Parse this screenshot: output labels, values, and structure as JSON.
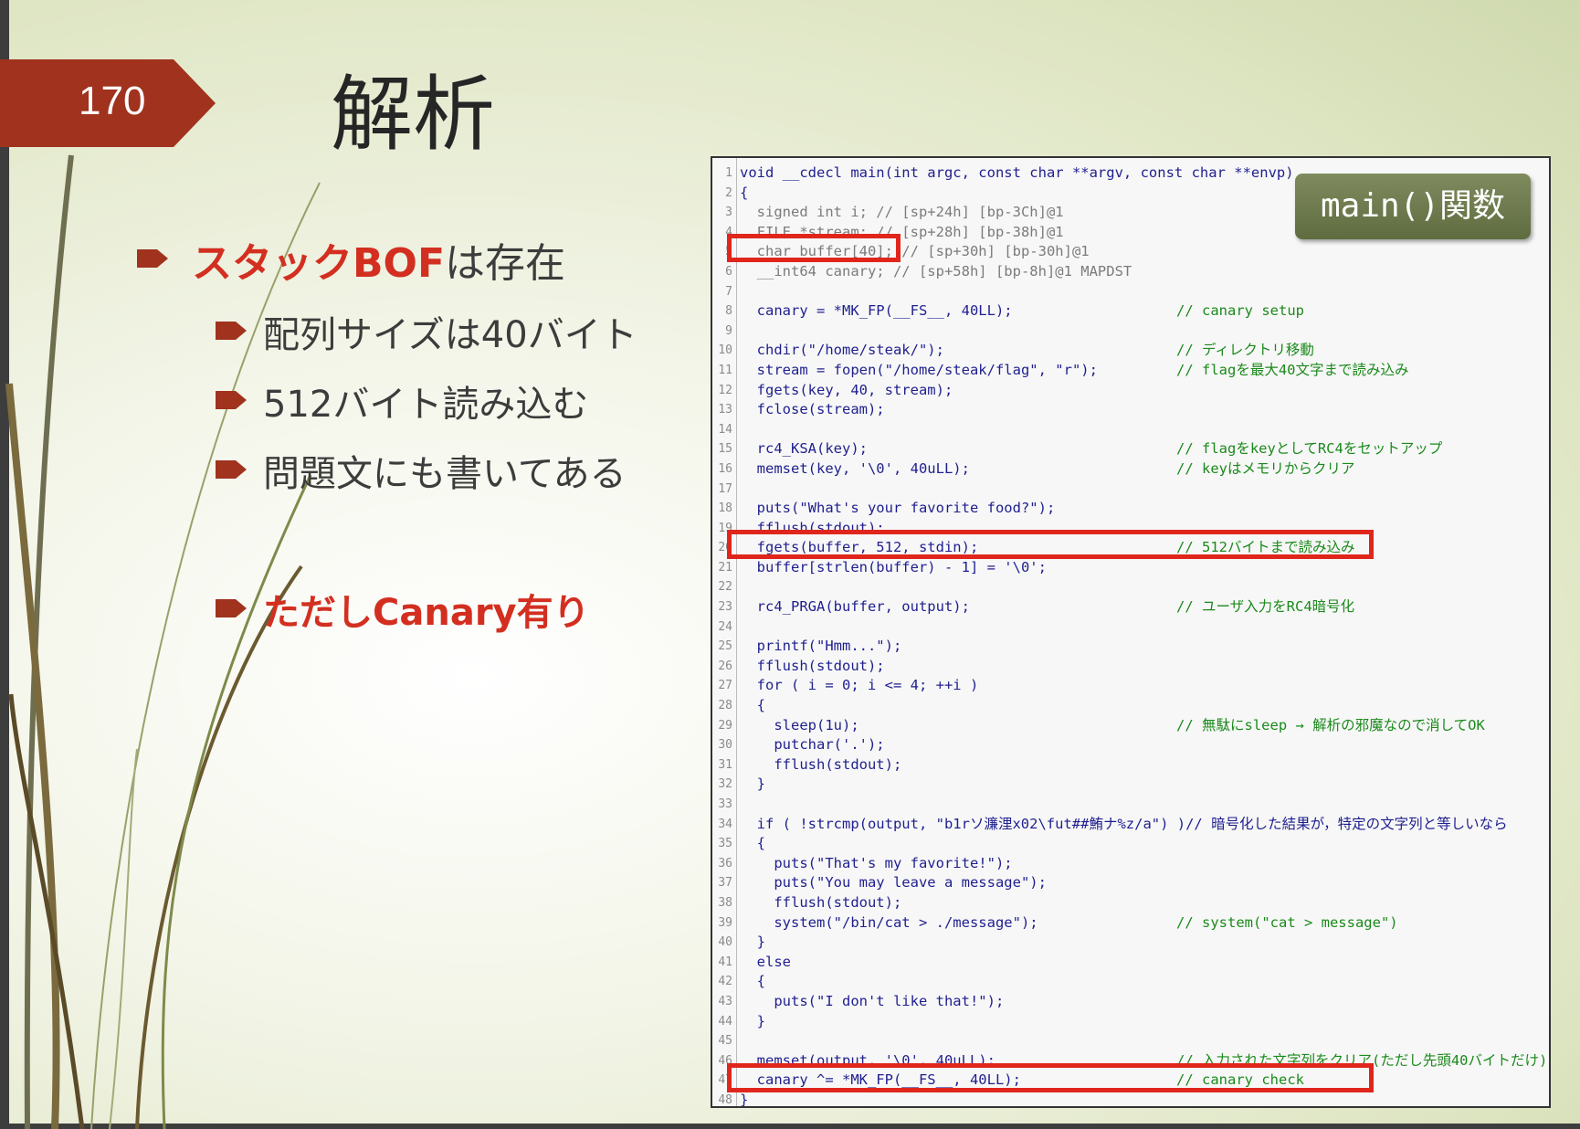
{
  "slide": {
    "page_number": "170",
    "title": "解析"
  },
  "bullets": {
    "main_prefix": "スタックBOF",
    "main_suffix": "は存在",
    "sub1": "配列サイズは40バイト",
    "sub2": "512バイト読み込む",
    "sub3": "問題文にも書いてある",
    "canary": "ただしCanary有り"
  },
  "badge": "main()関数",
  "code": [
    {
      "n": "1",
      "c": "void __cdecl main(int argc, const char **argv, const char **envp)",
      "m": ""
    },
    {
      "n": "2",
      "c": "{",
      "m": ""
    },
    {
      "n": "3",
      "c": "  signed int i; // [sp+24h] [bp-3Ch]@1",
      "m": ""
    },
    {
      "n": "4",
      "c": "  FILE *stream; // [sp+28h] [bp-38h]@1",
      "m": ""
    },
    {
      "n": "5",
      "c": "  char buffer[40]; // [sp+30h] [bp-30h]@1",
      "m": ""
    },
    {
      "n": "6",
      "c": "  __int64 canary; // [sp+58h] [bp-8h]@1 MAPDST",
      "m": ""
    },
    {
      "n": "7",
      "c": "",
      "m": ""
    },
    {
      "n": "8",
      "c": "  canary = *MK_FP(__FS__, 40LL);",
      "m": "// canary setup"
    },
    {
      "n": "9",
      "c": "",
      "m": ""
    },
    {
      "n": "10",
      "c": "  chdir(\"/home/steak/\");",
      "m": "// ディレクトリ移動"
    },
    {
      "n": "11",
      "c": "  stream = fopen(\"/home/steak/flag\", \"r\");",
      "m": "// flagを最大40文字まで読み込み"
    },
    {
      "n": "12",
      "c": "  fgets(key, 40, stream);",
      "m": ""
    },
    {
      "n": "13",
      "c": "  fclose(stream);",
      "m": ""
    },
    {
      "n": "14",
      "c": "",
      "m": ""
    },
    {
      "n": "15",
      "c": "  rc4_KSA(key);",
      "m": "// flagをkeyとしてRC4をセットアップ"
    },
    {
      "n": "16",
      "c": "  memset(key, '\\0', 40uLL);",
      "m": "// keyはメモリからクリア"
    },
    {
      "n": "17",
      "c": "",
      "m": ""
    },
    {
      "n": "18",
      "c": "  puts(\"What's your favorite food?\");",
      "m": ""
    },
    {
      "n": "19",
      "c": "  fflush(stdout);",
      "m": ""
    },
    {
      "n": "20",
      "c": "  fgets(buffer, 512, stdin);",
      "m": "// 512バイトまで読み込み"
    },
    {
      "n": "21",
      "c": "  buffer[strlen(buffer) - 1] = '\\0';",
      "m": ""
    },
    {
      "n": "22",
      "c": "",
      "m": ""
    },
    {
      "n": "23",
      "c": "  rc4_PRGA(buffer, output);",
      "m": "// ユーザ入力をRC4暗号化"
    },
    {
      "n": "24",
      "c": "",
      "m": ""
    },
    {
      "n": "25",
      "c": "  printf(\"Hmm...\");",
      "m": ""
    },
    {
      "n": "26",
      "c": "  fflush(stdout);",
      "m": ""
    },
    {
      "n": "27",
      "c": "  for ( i = 0; i <= 4; ++i )",
      "m": ""
    },
    {
      "n": "28",
      "c": "  {",
      "m": ""
    },
    {
      "n": "29",
      "c": "    sleep(1u);",
      "m": "// 無駄にsleep → 解析の邪魔なので消してOK"
    },
    {
      "n": "30",
      "c": "    putchar('.');",
      "m": ""
    },
    {
      "n": "31",
      "c": "    fflush(stdout);",
      "m": ""
    },
    {
      "n": "32",
      "c": "  }",
      "m": ""
    },
    {
      "n": "33",
      "c": "",
      "m": ""
    },
    {
      "n": "34",
      "c": "  if ( !strcmp(output, \"b1rソ濂浬x02\\fut##鮪ナ%z/a\") )// 暗号化した結果が，特定の文字列と等しいなら",
      "m": ""
    },
    {
      "n": "35",
      "c": "  {",
      "m": ""
    },
    {
      "n": "36",
      "c": "    puts(\"That's my favorite!\");",
      "m": ""
    },
    {
      "n": "37",
      "c": "    puts(\"You may leave a message\");",
      "m": ""
    },
    {
      "n": "38",
      "c": "    fflush(stdout);",
      "m": ""
    },
    {
      "n": "39",
      "c": "    system(\"/bin/cat > ./message\");",
      "m": "// system(\"cat > message\")"
    },
    {
      "n": "40",
      "c": "  }",
      "m": ""
    },
    {
      "n": "41",
      "c": "  else",
      "m": ""
    },
    {
      "n": "42",
      "c": "  {",
      "m": ""
    },
    {
      "n": "43",
      "c": "    puts(\"I don't like that!\");",
      "m": ""
    },
    {
      "n": "44",
      "c": "  }",
      "m": ""
    },
    {
      "n": "45",
      "c": "",
      "m": ""
    },
    {
      "n": "46",
      "c": "  memset(output, '\\0', 40uLL);",
      "m": "// 入力された文字列をクリア(ただし先頭40バイトだけ)"
    },
    {
      "n": "47",
      "c": "  canary ^= *MK_FP(__FS__, 40LL);",
      "m": "// canary check"
    },
    {
      "n": "48",
      "c": "}",
      "m": ""
    }
  ],
  "colors": {
    "accent_red": "#d32f20",
    "badge_brown": "#a0321e",
    "badge_green": "#6b7748",
    "highlight_box": "#e0261c",
    "code_comment": "#1b8a1b",
    "code_text": "#1f1f8f"
  }
}
